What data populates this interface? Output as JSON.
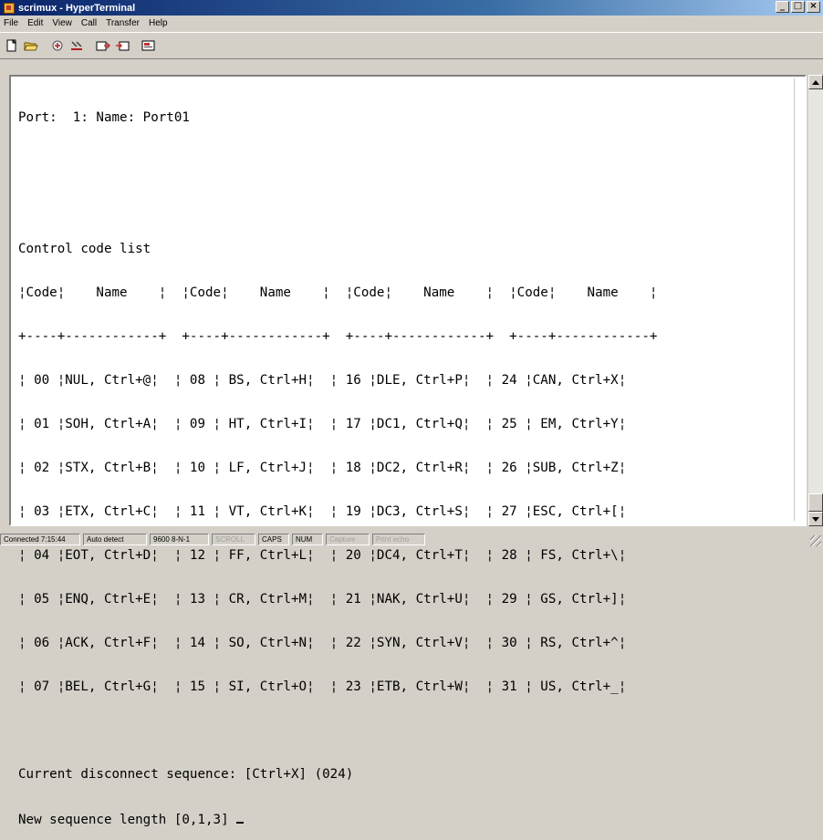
{
  "window": {
    "title": "scrimux - HyperTerminal",
    "min_glyph": "_",
    "max_glyph": "□",
    "close_glyph": "×"
  },
  "menu": [
    "File",
    "Edit",
    "View",
    "Call",
    "Transfer",
    "Help"
  ],
  "toolbar": [
    "new-connection-icon",
    "open-icon",
    "call-icon",
    "disconnect-icon",
    "send-icon",
    "receive-icon",
    "properties-icon"
  ],
  "terminal": {
    "lines": [
      "Port:  1: Name: Port01",
      "",
      "",
      "Control code list",
      "¦Code¦    Name    ¦  ¦Code¦    Name    ¦  ¦Code¦    Name    ¦  ¦Code¦    Name    ¦",
      "+----+------------+  +----+------------+  +----+------------+  +----+------------+",
      "¦ 00 ¦NUL, Ctrl+@¦  ¦ 08 ¦ BS, Ctrl+H¦  ¦ 16 ¦DLE, Ctrl+P¦  ¦ 24 ¦CAN, Ctrl+X¦",
      "¦ 01 ¦SOH, Ctrl+A¦  ¦ 09 ¦ HT, Ctrl+I¦  ¦ 17 ¦DC1, Ctrl+Q¦  ¦ 25 ¦ EM, Ctrl+Y¦",
      "¦ 02 ¦STX, Ctrl+B¦  ¦ 10 ¦ LF, Ctrl+J¦  ¦ 18 ¦DC2, Ctrl+R¦  ¦ 26 ¦SUB, Ctrl+Z¦",
      "¦ 03 ¦ETX, Ctrl+C¦  ¦ 11 ¦ VT, Ctrl+K¦  ¦ 19 ¦DC3, Ctrl+S¦  ¦ 27 ¦ESC, Ctrl+[¦",
      "¦ 04 ¦EOT, Ctrl+D¦  ¦ 12 ¦ FF, Ctrl+L¦  ¦ 20 ¦DC4, Ctrl+T¦  ¦ 28 ¦ FS, Ctrl+\\¦",
      "¦ 05 ¦ENQ, Ctrl+E¦  ¦ 13 ¦ CR, Ctrl+M¦  ¦ 21 ¦NAK, Ctrl+U¦  ¦ 29 ¦ GS, Ctrl+]¦",
      "¦ 06 ¦ACK, Ctrl+F¦  ¦ 14 ¦ SO, Ctrl+N¦  ¦ 22 ¦SYN, Ctrl+V¦  ¦ 30 ¦ RS, Ctrl+^¦",
      "¦ 07 ¦BEL, Ctrl+G¦  ¦ 15 ¦ SI, Ctrl+O¦  ¦ 23 ¦ETB, Ctrl+W¦  ¦ 31 ¦ US, Ctrl+_¦",
      "",
      "Current disconnect sequence: [Ctrl+X] (024)"
    ],
    "prompt": "New sequence length [0,1,3] "
  },
  "status": {
    "connected": "Connected 7:15:44",
    "detect": "Auto detect",
    "settings": "9600 8-N-1",
    "scroll": "SCROLL",
    "caps": "CAPS",
    "num": "NUM",
    "capture": "Capture",
    "print_echo": "Print echo"
  },
  "colors": {
    "title_bar": "#0a246a",
    "chrome": "#d4d0c8",
    "terminal_bg": "#ffffff"
  }
}
